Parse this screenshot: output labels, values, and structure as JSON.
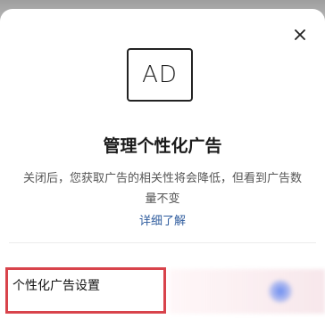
{
  "dialog": {
    "close_label": "×",
    "ad_badge": "AD",
    "title": "管理个性化广告",
    "description": "关闭后，您获取广告的相关性将会降低，但看到广告数量不变",
    "learn_more": "详细了解"
  },
  "settings": {
    "row_label": "个性化广告设置",
    "toggle_state": "on"
  },
  "colors": {
    "link": "#2f5c9e",
    "highlight": "#d8434b",
    "toggle": "#6a8cf0"
  }
}
